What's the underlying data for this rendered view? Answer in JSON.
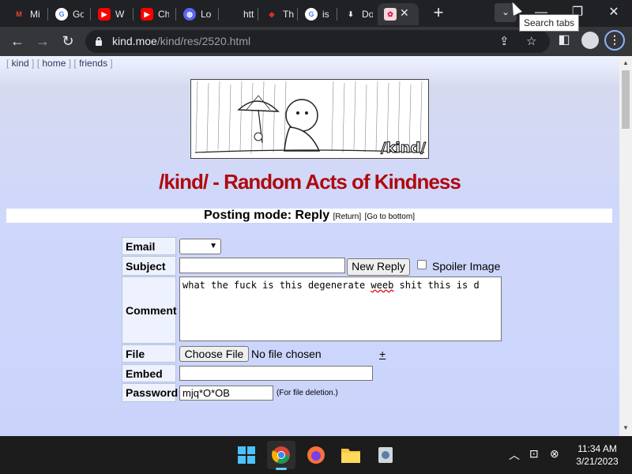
{
  "browser": {
    "tabs": [
      {
        "icon": "M",
        "icon_color": "#ea4335",
        "label": "Mi"
      },
      {
        "icon": "G",
        "icon_color": "#4285f4",
        "label": "Go"
      },
      {
        "icon": "▶",
        "icon_color": "#ff0000",
        "label": "W"
      },
      {
        "icon": "▶",
        "icon_color": "#ff0000",
        "label": "Ch"
      },
      {
        "icon": "◍",
        "icon_color": "#5865f2",
        "label": "Lo"
      },
      {
        "icon": "",
        "icon_color": "#202124",
        "label": "htt"
      },
      {
        "icon": "◆",
        "icon_color": "#d93025",
        "label": "Th"
      },
      {
        "icon": "G",
        "icon_color": "#4285f4",
        "label": "is"
      },
      {
        "icon": "⬇",
        "icon_color": "#e8eaed",
        "label": "Do"
      },
      {
        "icon": "✿",
        "icon_color": "#f28b82",
        "label": ""
      }
    ],
    "new_tab": "+",
    "tooltip": "Search tabs",
    "url_host": "kind.moe",
    "url_path": "/kind/res/2520.html"
  },
  "page": {
    "boardlist": [
      "kind",
      "home",
      "friends"
    ],
    "banner_text": "/kind/",
    "board_title": "/kind/ - Random Acts of Kindness",
    "postmode": "Posting mode: Reply",
    "return_link": "[Return]",
    "bottom_link": "[Go to bottom]",
    "form": {
      "email_label": "Email",
      "subject_label": "Subject",
      "comment_label": "Comment",
      "file_label": "File",
      "embed_label": "Embed",
      "password_label": "Password",
      "submit": "New Reply",
      "spoiler": "Spoiler Image",
      "comment_before": "what the fuck is this degenerate ",
      "comment_squiggle": "weeb",
      "comment_after": " shit this is d",
      "choose_file": "Choose File",
      "no_file": "No file chosen",
      "add_file": "+",
      "password_value": "mjq*O*OB",
      "file_deletion_note": "(For file deletion.)"
    }
  },
  "taskbar": {
    "time": "11:34 AM",
    "date": "3/21/2023"
  }
}
